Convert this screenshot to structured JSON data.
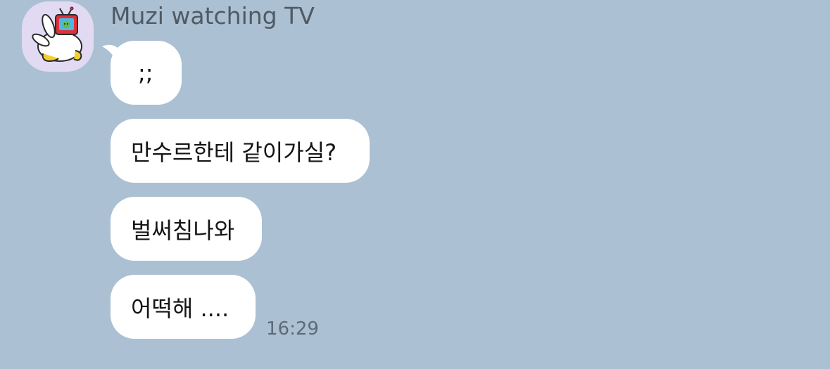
{
  "theme": {
    "background": "#abc0d3",
    "bubble": "#ffffff",
    "avatar_background": "#e2daf3"
  },
  "sender": {
    "name": "Muzi watching TV",
    "avatar_icon": "muzi-with-tv-icon"
  },
  "messages": [
    {
      "text": ";;"
    },
    {
      "text": "만수르한테 같이가실?"
    },
    {
      "text": "벌써침나와"
    },
    {
      "text": "어떡해 ...."
    }
  ],
  "timestamp": "16:29"
}
